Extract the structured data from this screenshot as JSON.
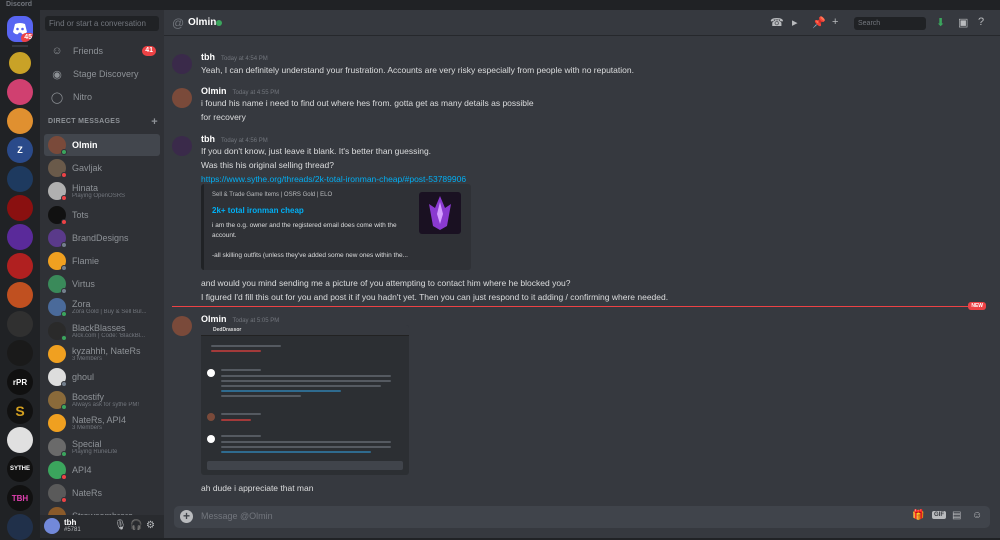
{
  "app": {
    "title": "Discord"
  },
  "servers": [
    {
      "icon": "discord-home-icon",
      "badge": "45"
    },
    {
      "label": ""
    },
    {
      "label": ""
    },
    {
      "label": ""
    },
    {
      "label": "Z"
    },
    {
      "label": ""
    },
    {
      "label": ""
    },
    {
      "label": ""
    },
    {
      "label": ""
    },
    {
      "label": ""
    },
    {
      "label": ""
    },
    {
      "label": ""
    },
    {
      "label": "rPR"
    },
    {
      "label": "S"
    },
    {
      "label": ""
    },
    {
      "label": "SYTHE"
    },
    {
      "label": "TBH"
    },
    {
      "label": ""
    }
  ],
  "sidebar": {
    "search_placeholder": "Find or start a conversation",
    "nav": [
      {
        "label": "Friends",
        "icon": "friends-icon",
        "badge": "41"
      },
      {
        "label": "Stage Discovery",
        "icon": "stage-icon"
      },
      {
        "label": "Nitro",
        "icon": "nitro-icon"
      }
    ],
    "dm_header": "DIRECT MESSAGES",
    "dms": [
      {
        "name": "Olmin",
        "sub": "",
        "color": "#7a4a3a",
        "status": "#3ba55d",
        "active": true
      },
      {
        "name": "Gavljak",
        "sub": "",
        "color": "#6a5a4a",
        "status": "#ed4245"
      },
      {
        "name": "Hinata",
        "sub": "Playing OpenOSRS",
        "color": "#b0b0b0",
        "status": "#ed4245"
      },
      {
        "name": "Tots",
        "sub": "",
        "color": "#111111",
        "status": "#ed4245"
      },
      {
        "name": "BrandDesigns",
        "sub": "",
        "color": "#5a3a8a",
        "status": "#747f8d"
      },
      {
        "name": "Flamie",
        "sub": "",
        "color": "#f0a020",
        "status": "#747f8d"
      },
      {
        "name": "Virtus",
        "sub": "",
        "color": "#3a8a5a",
        "status": "#747f8d"
      },
      {
        "name": "Zora",
        "sub": "Zora Gold | Buy & Sell Bul...",
        "color": "#4a6a9a",
        "status": "#3ba55d"
      },
      {
        "name": "BlackBlasses",
        "sub": "Alck.com | Code: 'BlackBl...",
        "color": "#2a2a2a",
        "status": "#3ba55d"
      },
      {
        "name": "kyzahhh, NateRs",
        "sub": "3 Members",
        "color": "#f0a020",
        "status": ""
      },
      {
        "name": "ghoul",
        "sub": "",
        "color": "#dddddd",
        "status": "#747f8d"
      },
      {
        "name": "Boostify",
        "sub": "Always ask for sythe PM!",
        "color": "#8a6a3a",
        "status": "#3ba55d"
      },
      {
        "name": "NateRs, API4",
        "sub": "3 Members",
        "color": "#f0a020",
        "status": ""
      },
      {
        "name": "Special",
        "sub": "Playing RuneLite",
        "color": "#6a6a6a",
        "status": "#3ba55d"
      },
      {
        "name": "API4",
        "sub": "",
        "color": "#3ba55d",
        "status": "#ed4245"
      },
      {
        "name": "NateRs",
        "sub": "",
        "color": "#5a5a5a",
        "status": "#ed4245"
      },
      {
        "name": "Strawsombrero",
        "sub": "",
        "color": "#8a5a2a",
        "status": "#747f8d"
      }
    ]
  },
  "user": {
    "name": "tbh",
    "tag": "#5781"
  },
  "channel": {
    "name": "Olmin",
    "search_placeholder": "Search"
  },
  "messages": [
    {
      "author": "tbh",
      "time": "Today at 4:54 PM",
      "lines": [
        "Yeah, I can definitely understand your frustration. Accounts are very risky especially from people with no reputation."
      ]
    },
    {
      "author": "Olmin",
      "time": "Today at 4:55 PM",
      "lines": [
        "i found his name i need to find out where hes from. gotta get as many details as possible",
        "for recovery"
      ]
    },
    {
      "author": "tbh",
      "time": "Today at 4:56 PM",
      "lines": [
        "If you don't know, just leave it blank. It's better than guessing.",
        "Was this his original selling thread?"
      ],
      "link": "https://www.sythe.org/threads/2k-total-ironman-cheap/#post-53789906",
      "embed": {
        "provider": "Sell & Trade Game Items | OSRS Gold | ELO",
        "title": "2k+ total ironman cheap",
        "description": "i am the o.g. owner and the registered email does come with the account.\n\n-all skilling outfits (unless they've added some new ones within the..."
      },
      "after": [
        "and would you mind sending me a picture of you attempting to contact him where he blocked you?",
        "I figured I'd fill this out for you and post it if you hadn't yet. Then you can just respond to it adding / confirming where needed."
      ]
    },
    {
      "author": "Olmin",
      "time": "Today at 5:05 PM",
      "screenshot_title": "DedDrassor",
      "lines": [
        "ah dude i appreciate that man"
      ]
    }
  ],
  "new_label": "NEW",
  "composer": {
    "placeholder": "Message @Olmin",
    "gif_label": "GIF"
  }
}
